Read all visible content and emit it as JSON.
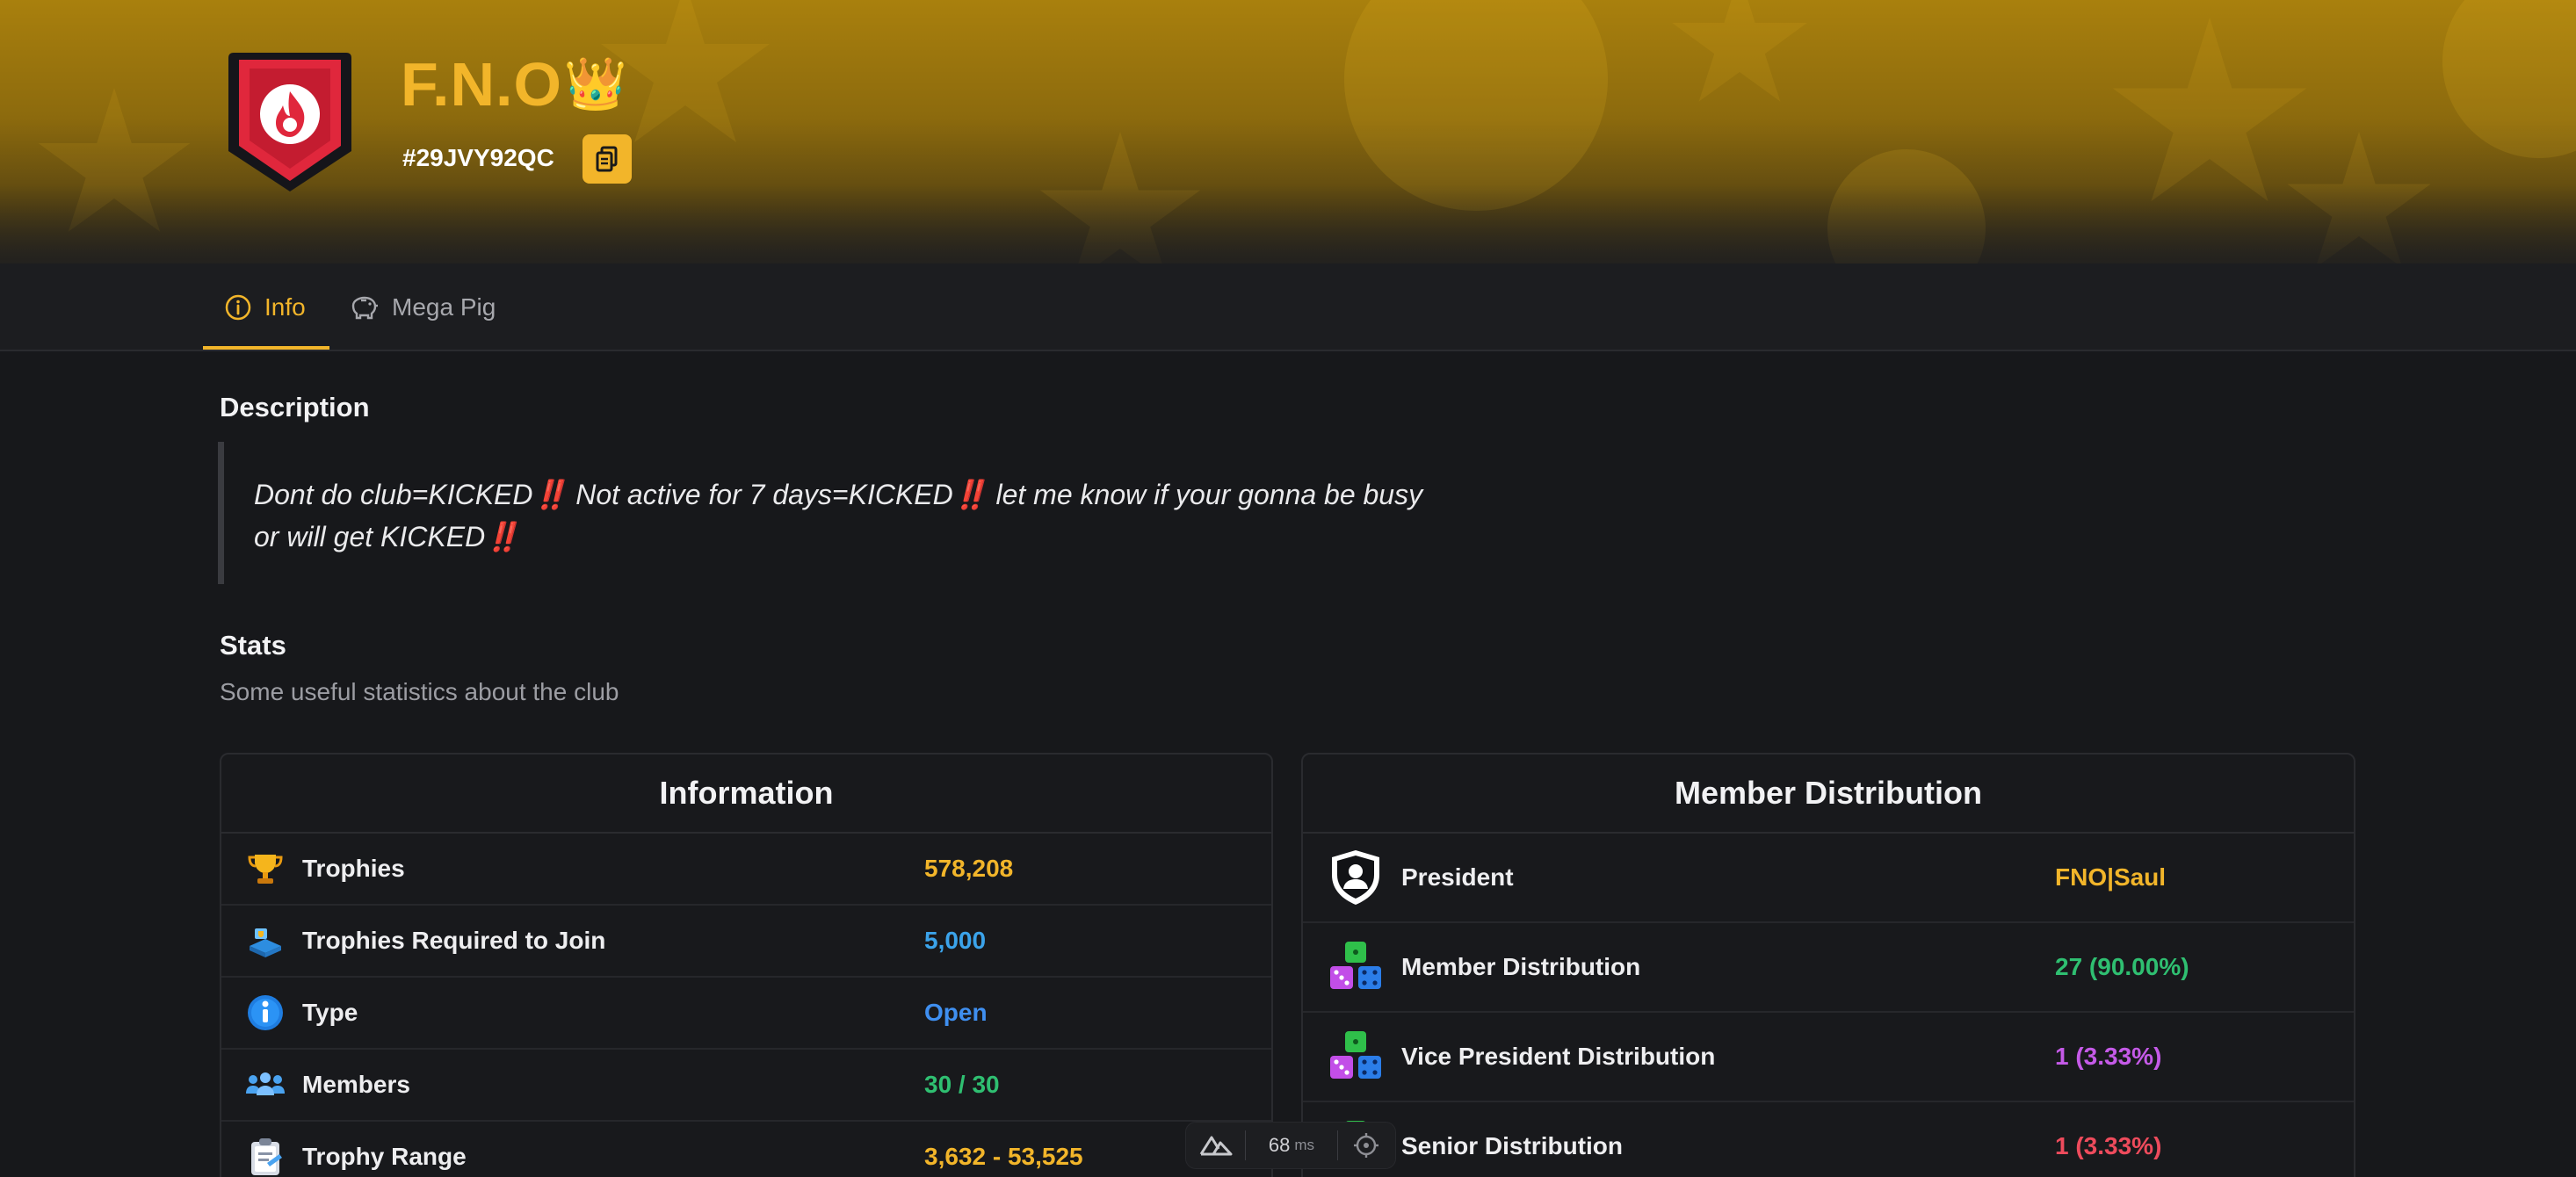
{
  "club": {
    "name": "F.N.O",
    "crown_emoji": "👑",
    "tag": "#29JVY92QC"
  },
  "tabs": [
    {
      "label": "Info",
      "icon": "info-circle-icon",
      "active": true
    },
    {
      "label": "Mega Pig",
      "icon": "piggy-bank-icon",
      "active": false
    }
  ],
  "description": {
    "title": "Description",
    "line1": "Dont do club=KICKED",
    "line1b": " Not active for 7 days=KICKED",
    "line1c": " let me know if your gonna be busy",
    "line2": "or will get KICKED",
    "emphasis": "‼️"
  },
  "stats": {
    "title": "Stats",
    "subtitle": "Some useful statistics about the club"
  },
  "information": {
    "title": "Information",
    "rows": [
      {
        "label": "Trophies",
        "value": "578,208",
        "color": "#f2b52a",
        "icon": "trophy-icon"
      },
      {
        "label": "Trophies Required to Join",
        "value": "5,000",
        "color": "#3ba3ea",
        "icon": "trophy-road-icon"
      },
      {
        "label": "Type",
        "value": "Open",
        "color": "#3f8ff0",
        "icon": "info-icon"
      },
      {
        "label": "Members",
        "value": "30 / 30",
        "color": "#2fbf71",
        "icon": "members-icon"
      },
      {
        "label": "Trophy Range",
        "value": "3,632 - 53,525",
        "color": "#f2b52a",
        "icon": "clipboard-icon"
      }
    ]
  },
  "member_distribution": {
    "title": "Member Distribution",
    "rows": [
      {
        "label": "President",
        "value": "FNO|Saul",
        "color": "#f2b52a",
        "icon": "president-shield-icon"
      },
      {
        "label": "Member Distribution",
        "value": "27 (90.00%)",
        "color": "#2fbf71",
        "icon": "dice-icon"
      },
      {
        "label": "Vice President Distribution",
        "value": "1 (3.33%)",
        "color": "#c55ae8",
        "icon": "dice-icon"
      },
      {
        "label": "Senior Distribution",
        "value": "1 (3.33%)",
        "color": "#ee4b5c",
        "icon": "dice-icon"
      }
    ]
  },
  "devtools": {
    "latency": "68",
    "unit": "ms"
  }
}
